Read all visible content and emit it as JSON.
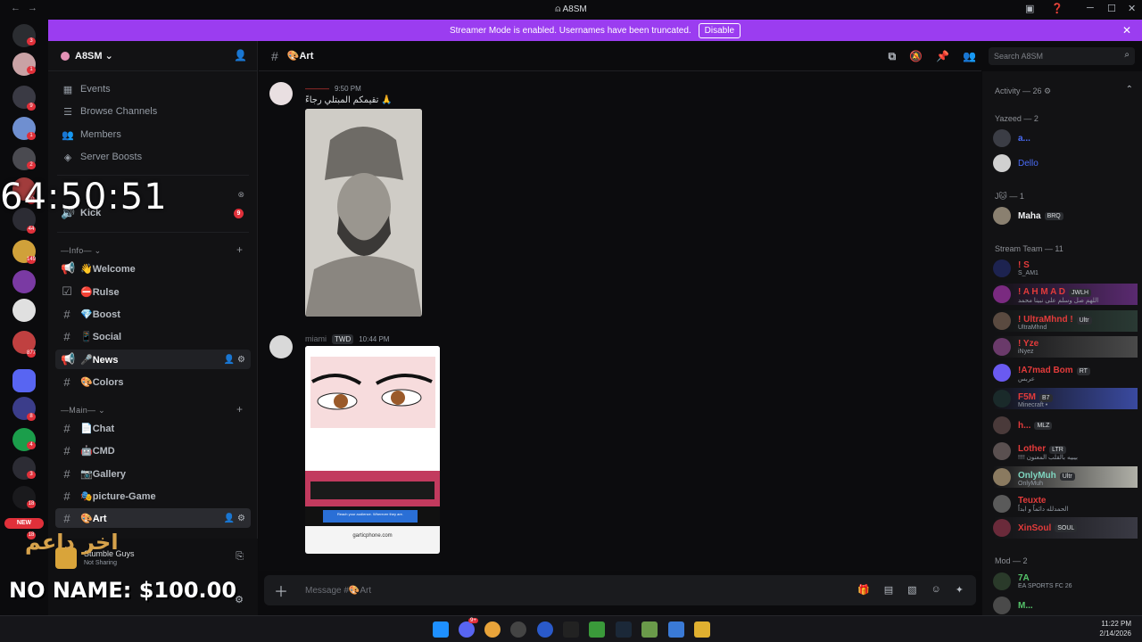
{
  "window": {
    "title": "A8SM"
  },
  "banner": {
    "text": "Streamer Mode is enabled. Usernames have been truncated.",
    "button": "Disable"
  },
  "guild_badges": [
    "3",
    "1",
    "9",
    "1",
    "2",
    "20",
    "44",
    "149",
    "877",
    "8",
    "4",
    "3",
    "18",
    "18"
  ],
  "guild_new_label": "NEW",
  "server": {
    "name": "A8SM",
    "menu": [
      {
        "label": "Events",
        "icon": "calendar-icon"
      },
      {
        "label": "Browse Channels",
        "icon": "browse-icon"
      },
      {
        "label": "Members",
        "icon": "members-icon"
      },
      {
        "label": "Server Boosts",
        "icon": "boost-icon"
      }
    ],
    "live_channel": {
      "name": "Kick",
      "badge": "9"
    },
    "categories": [
      {
        "name": "—Info—",
        "channels": [
          "👋Welcome",
          "⛔Rulse",
          "💎Boost",
          "📱Social",
          "🎤News",
          "🎨Colors"
        ]
      },
      {
        "name": "—Main—",
        "channels": [
          "📄Chat",
          "🤖CMD",
          "📷Gallery",
          "🎭picture-Game",
          "🎨Art"
        ]
      }
    ],
    "user_panel": {
      "activity": "Stumble Guys",
      "status": "Not Sharing"
    }
  },
  "overlay": {
    "timer": "64:50:51",
    "caption": "NO NAME: $100.00",
    "arabic": "اخر داعم"
  },
  "chat": {
    "channel": "🎨Art",
    "messages": [
      {
        "author": "———",
        "time": "9:50 PM",
        "text": "تقيمكم المبتلي رجاءً 🙏"
      },
      {
        "author": "miami",
        "tag": "TWD",
        "time": "10:44 PM",
        "text": ""
      }
    ],
    "attachment2": {
      "ad_text": "Reach your audience. Wherever they are.",
      "url": "garticphone.com"
    },
    "composer_placeholder": "Message #🎨Art"
  },
  "search": {
    "placeholder": "Search A8SM"
  },
  "members": {
    "activity": "Activity — 26",
    "groups": [
      {
        "title": "Yazeed — 2",
        "items": [
          {
            "name": "a...",
            "color": "#4a6cf7"
          },
          {
            "name": "Dello",
            "color": "#4a6cf7"
          }
        ]
      },
      {
        "title": "J🐱 — 1",
        "items": [
          {
            "name": "Maha",
            "tag": "BRQ",
            "color": "#f2f3f5"
          }
        ]
      },
      {
        "title": "Stream Team — 11",
        "items": [
          {
            "name": "! S",
            "sub": "S_AM1",
            "color": "#e33b3b"
          },
          {
            "name": "! A H M A D",
            "tag": "JWLH",
            "sub": "اللهم صل وسلم على نبينا محمد",
            "color": "#e33b3b"
          },
          {
            "name": "! UltraMhnd !",
            "tag": "Ultr",
            "sub": "UltraMhnd",
            "color": "#e33b3b"
          },
          {
            "name": "! Yze",
            "sub": "iNyez",
            "color": "#e33b3b"
          },
          {
            "name": "!A7mad Bom",
            "tag": "RT",
            "sub": "عربس",
            "color": "#e33b3b"
          },
          {
            "name": "F5M",
            "tag": "B7",
            "sub": "Minecraft •",
            "color": "#e33b3b"
          },
          {
            "name": "h...",
            "tag": "MLZ",
            "color": "#e33b3b"
          },
          {
            "name": "Lother",
            "tag": "LTR",
            "sub": "!!!! بيبيه بالقلب المعنون",
            "color": "#e33b3b"
          },
          {
            "name": "OnlyMuh",
            "tag": "Ultr",
            "sub": "OnlyMuh",
            "color": "#7fd6c0"
          },
          {
            "name": "Teuxte",
            "sub": "الحمدلله دائماً و ابداً",
            "color": "#e33b3b"
          },
          {
            "name": "XinSoul",
            "tag": "SOUL",
            "color": "#e33b3b"
          }
        ]
      },
      {
        "title": "Mod — 2",
        "items": [
          {
            "name": "7A",
            "sub": "EA SPORTS FC 26",
            "color": "#55c46a"
          },
          {
            "name": "M...",
            "color": "#55c46a"
          }
        ]
      }
    ]
  },
  "taskbar": {
    "time": "11:22 PM",
    "date": "2/14/2026",
    "discord_badge": "9+"
  }
}
